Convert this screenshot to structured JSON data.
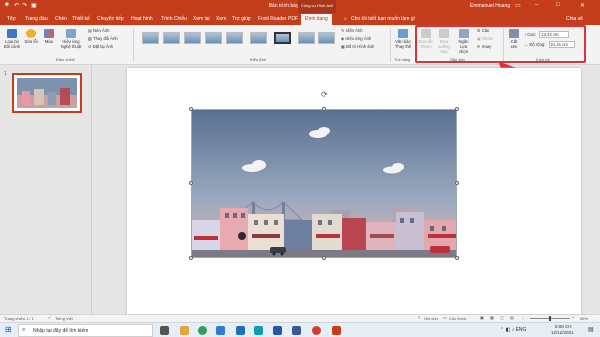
{
  "window": {
    "title": "Bản trình bày1 - PowerPoint",
    "contextual_group": "Công cụ Hình ảnh",
    "user": "Emmanuel Hoang"
  },
  "tabs": [
    "Tệp",
    "Trang đầu",
    "Chèn",
    "Thiết kế",
    "Chuyển tiếp",
    "Hoạt hình",
    "Trình Chiếu",
    "Xem lại",
    "Xem",
    "Trợ giúp",
    "Foxit Reader PDF",
    "Định dạng"
  ],
  "tell_me": "Cho tôi biết bạn muốn làm gì",
  "share": "Chia sẻ",
  "ribbon": {
    "adjust": {
      "remove_bg": "Loại bỏ Bối cảnh",
      "corrections": "Sửa lỗi",
      "color": "Màu",
      "artistic": "Hiệu ứng Nghệ thuật",
      "compress": "Nén Ảnh",
      "change": "Thay đổi Ảnh",
      "reset": "Đặt lại Ảnh",
      "group_label": "Điều chỉnh"
    },
    "styles": {
      "group_label": "Kiểu Ảnh",
      "border": "Viền Ảnh",
      "effects": "Hiệu ứng Ảnh",
      "layout": "Bố trí Hình ảnh"
    },
    "accessibility": {
      "alt_text": "Văn bản Thay thế",
      "group_label": "Trợ năng"
    },
    "arrange": {
      "bring_forward": "Đưa lên Trước",
      "send_backward": "Đưa xuống Sau",
      "selection_pane": "Ngăn Lựa chọn",
      "align": "Căn",
      "group": "Nhóm",
      "rotate": "Xoay",
      "group_label": "Sắp xếp"
    },
    "size": {
      "crop": "Cắt xén",
      "height_label": "Cao:",
      "height_value": "13,42 cm",
      "width_label": "Độ rộng:",
      "width_value": "21,41 cm",
      "group_label": "Kích cỡ"
    }
  },
  "slide_number": "1",
  "status": {
    "slide_info": "Trang chiếu 1 / 1",
    "language": "Tiếng Việt",
    "notes": "Ghi chú",
    "comments": "Chú thích",
    "zoom": "56%"
  },
  "taskbar": {
    "search_placeholder": "Nhập tại đây để tìm kiếm",
    "time": "5:08 CH",
    "date": "12/12/2021"
  },
  "colors": {
    "accent": "#c43e1c",
    "highlight": "#e0303a"
  }
}
